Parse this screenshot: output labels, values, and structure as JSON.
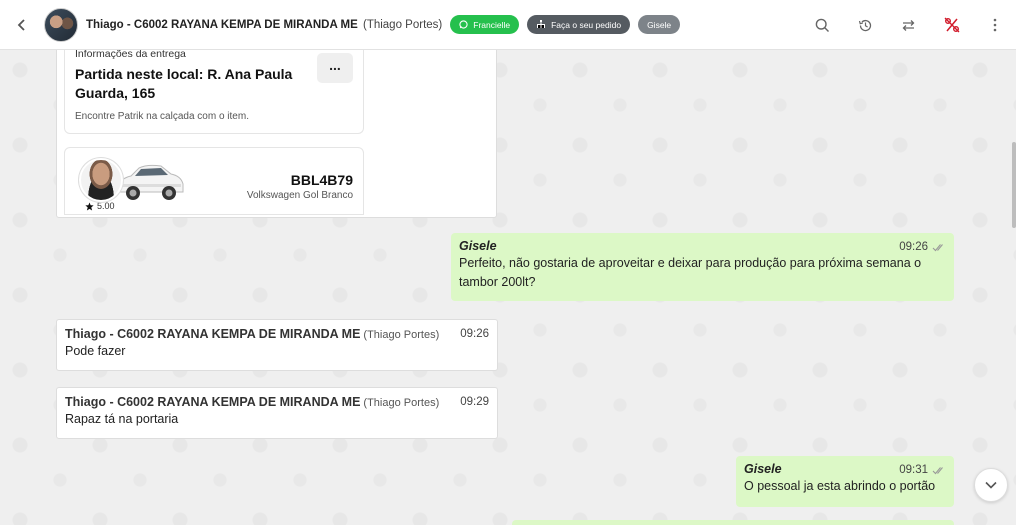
{
  "header": {
    "title": "Thiago - C6002 RAYANA KEMPA DE MIRANDA ME",
    "subtitle": "(Thiago Portes)",
    "chips": [
      {
        "label": "Francielle",
        "color": "#25c04d",
        "icon": "whatsapp-icon"
      },
      {
        "label": "Faça o seu pedido",
        "color": "#555b61",
        "icon": "hierarchy-icon"
      },
      {
        "label": "Gisele",
        "color": "#7d8389"
      }
    ],
    "actions": [
      "search-icon",
      "history-icon",
      "transfer-icon",
      "percent-icon",
      "more-vertical-icon"
    ]
  },
  "delivery": {
    "section_label": "Informações da entrega",
    "address": "Partida neste local: R. Ana Paula Guarda, 165",
    "note": "Encontre Patrik na calçada com o item.",
    "menu": "...",
    "plate": "BBL4B79",
    "vehicle": "Volkswagen Gol Branco",
    "rating": "5.00"
  },
  "messages": [
    {
      "direction": "out",
      "sender": "Gisele",
      "time": "09:26",
      "text": "Perfeito, não gostaria de aproveitar e deixar para produção para próxima semana o tambor 200lt?"
    },
    {
      "direction": "in",
      "sender": "Thiago - C6002 RAYANA KEMPA DE MIRANDA ME",
      "sender_sub": "(Thiago Portes)",
      "time": "09:26",
      "text": "Pode fazer"
    },
    {
      "direction": "in",
      "sender": "Thiago - C6002 RAYANA KEMPA DE MIRANDA ME",
      "sender_sub": "(Thiago Portes)",
      "time": "09:29",
      "text": "Rapaz tá na portaria"
    },
    {
      "direction": "out",
      "sender": "Gisele",
      "time": "09:31",
      "text": "O pessoal ja esta abrindo o portão"
    }
  ],
  "colors": {
    "outgoing_bubble": "#dcf8c6",
    "incoming_bubble": "#ffffff",
    "background": "#efefef"
  }
}
